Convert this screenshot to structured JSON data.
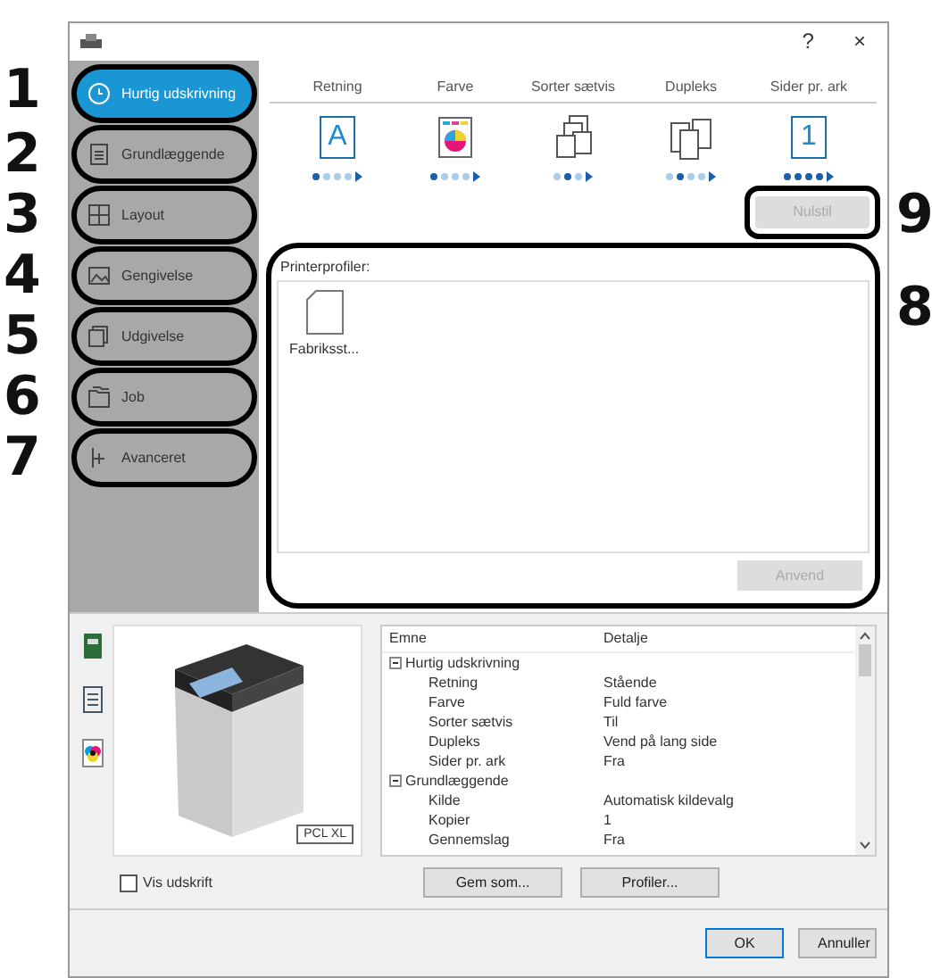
{
  "callouts": [
    "1",
    "2",
    "3",
    "4",
    "5",
    "6",
    "7",
    "8",
    "9"
  ],
  "window": {
    "help": "?",
    "close": "×"
  },
  "tabs": [
    {
      "label": "Hurtig udskrivning",
      "selected": true
    },
    {
      "label": "Grundlæggende",
      "selected": false
    },
    {
      "label": "Layout",
      "selected": false
    },
    {
      "label": "Gengivelse",
      "selected": false
    },
    {
      "label": "Udgivelse",
      "selected": false
    },
    {
      "label": "Job",
      "selected": false
    },
    {
      "label": "Avanceret",
      "selected": false
    }
  ],
  "quick_settings": [
    {
      "label": "Retning",
      "kind": "letter",
      "glyph": "A",
      "dots": [
        true,
        false,
        false,
        false
      ]
    },
    {
      "label": "Farve",
      "kind": "color",
      "dots": [
        true,
        false,
        false,
        false
      ]
    },
    {
      "label": "Sorter sætvis",
      "kind": "collate",
      "dots": [
        false,
        true,
        false
      ]
    },
    {
      "label": "Dupleks",
      "kind": "duplex",
      "dots": [
        false,
        true,
        false,
        false
      ]
    },
    {
      "label": "Sider pr. ark",
      "kind": "letter",
      "glyph": "1",
      "dots": [
        true,
        true,
        true,
        true
      ]
    }
  ],
  "reset_button": {
    "label": "Nulstil",
    "disabled": true
  },
  "profiles": {
    "title": "Printerprofiler:",
    "items": [
      {
        "label": "Fabriksst..."
      }
    ],
    "apply_button": {
      "label": "Anvend",
      "disabled": true
    }
  },
  "preview": {
    "badge": "PCL XL"
  },
  "summary": {
    "columns": [
      "Emne",
      "Detalje"
    ],
    "groups": [
      {
        "name": "Hurtig udskrivning",
        "expanded": true,
        "rows": [
          [
            "Retning",
            "Stående"
          ],
          [
            "Farve",
            "Fuld farve"
          ],
          [
            "Sorter sætvis",
            "Til"
          ],
          [
            "Dupleks",
            "Vend på lang side"
          ],
          [
            "Sider pr. ark",
            "Fra"
          ]
        ]
      },
      {
        "name": "Grundlæggende",
        "expanded": true,
        "rows": [
          [
            "Kilde",
            "Automatisk kildevalg"
          ],
          [
            "Kopier",
            "1"
          ],
          [
            "Gennemslag",
            "Fra"
          ]
        ]
      }
    ]
  },
  "show_print": {
    "label": "Vis udskrift",
    "checked": false
  },
  "buttons": {
    "save_as": "Gem som...",
    "profiles": "Profiler...",
    "ok": "OK",
    "cancel": "Annuller"
  }
}
